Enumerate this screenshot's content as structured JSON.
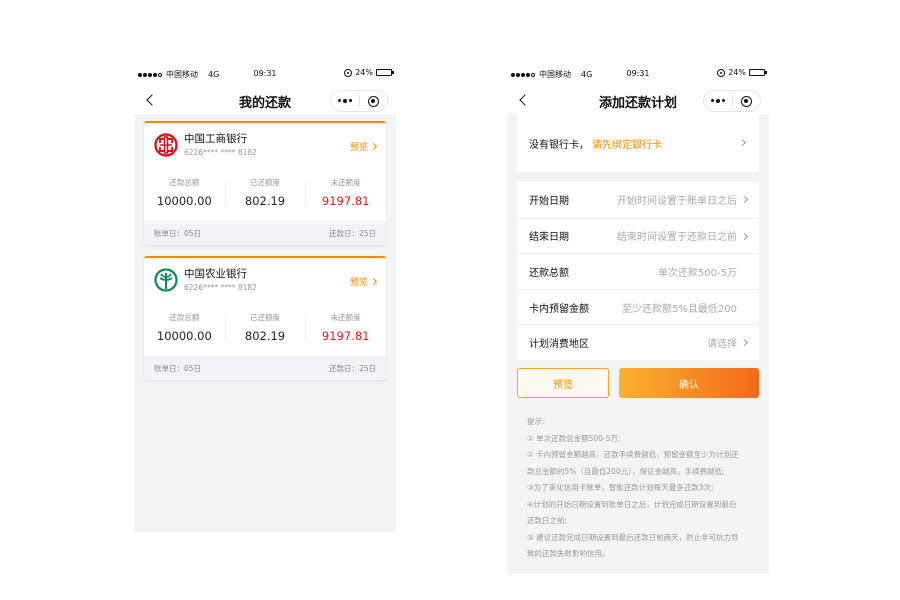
{
  "status": {
    "carrier": "中国移动",
    "network": "4G",
    "time": "09:31",
    "battery": "24%",
    "battery_level": 0.24
  },
  "left": {
    "title": "我的还款",
    "cards": [
      {
        "bank": "中国工商银行",
        "card_no": "6226**** **** 8182",
        "preview": "预览",
        "total_label": "还款总额",
        "total": "10000.00",
        "paid_label": "已还额度",
        "paid": "802.19",
        "unpaid_label": "未还额度",
        "unpaid": "9197.81",
        "bill_day": "账单日：05日",
        "due_day": "还款日：25日"
      },
      {
        "bank": "中国农业银行",
        "card_no": "6226**** **** 8182",
        "preview": "预览",
        "total_label": "还款总额",
        "total": "10000.00",
        "paid_label": "已还额度",
        "paid": "802.19",
        "unpaid_label": "未还额度",
        "unpaid": "9197.81",
        "bill_day": "账单日：05日",
        "due_day": "还款日：25日"
      }
    ]
  },
  "right": {
    "title": "添加还款计划",
    "bind": {
      "text": "没有银行卡，",
      "link": "请先绑定银行卡"
    },
    "rows": [
      {
        "label": "开始日期",
        "placeholder": "开始时间设置于账单日之后"
      },
      {
        "label": "结束日期",
        "placeholder": "结束时间设置于还款日之前"
      },
      {
        "label": "还款总额",
        "placeholder": "单次还款500-5万"
      },
      {
        "label": "卡内预留金额",
        "placeholder": "至少还款额5%且最低200"
      },
      {
        "label": "计划消费地区",
        "placeholder": "请选择"
      }
    ],
    "preview_button": "预览",
    "confirm_button": "确认",
    "tips": [
      "提示：",
      "① 单次还款总金额500-5万;",
      "② 卡内预留金额越高，还款手续费越低，预留金额至少为计划还",
      "款总金额的5%（且最低200元），保证金越高，手续费越低;",
      "③为了美化信用卡账单，智能还款计划每天最多还款3次;",
      "④计划的开始日期设置到账单日之后，计划完成日期设置到最后",
      "还款日之前;",
      "⑤ 建议还款完成日期设置到最后还款日前两天，防止非可抗力导",
      "致的还款失败影响信用。"
    ]
  },
  "colors": {
    "accent": "#f08a00",
    "red": "#e8161e",
    "icbc": "#d7191f",
    "abc": "#0a8a5a"
  },
  "icons": [
    "signal-dots",
    "alarm-icon",
    "battery-icon",
    "back-arrow-icon",
    "more-dots-icon",
    "target-icon",
    "icbc-logo",
    "abc-logo",
    "chevron-right-icon"
  ]
}
